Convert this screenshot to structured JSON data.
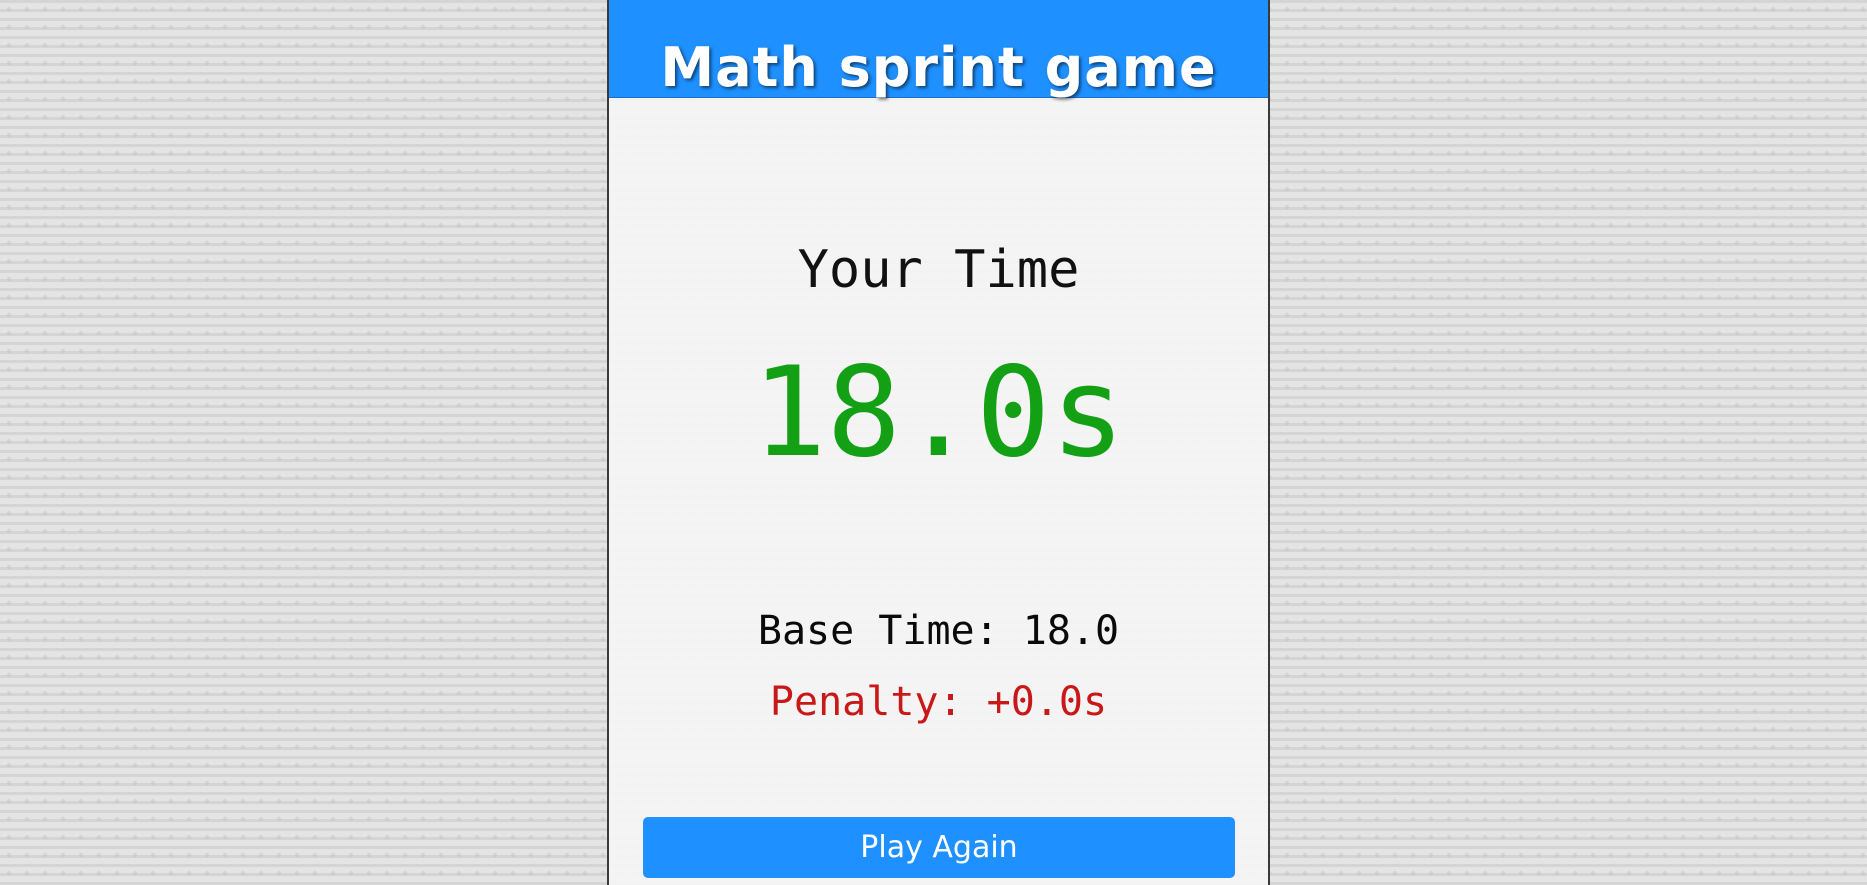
{
  "header": {
    "title": "Math sprint game"
  },
  "score_page": {
    "heading": "Your Time",
    "final_time": "18.0s",
    "base_time": "Base Time: 18.0",
    "penalty_time": "Penalty: +0.0s",
    "play_again_label": "Play Again"
  },
  "colors": {
    "accent": "#1e90ff",
    "final_time": "#14a014",
    "penalty": "#c81818"
  }
}
